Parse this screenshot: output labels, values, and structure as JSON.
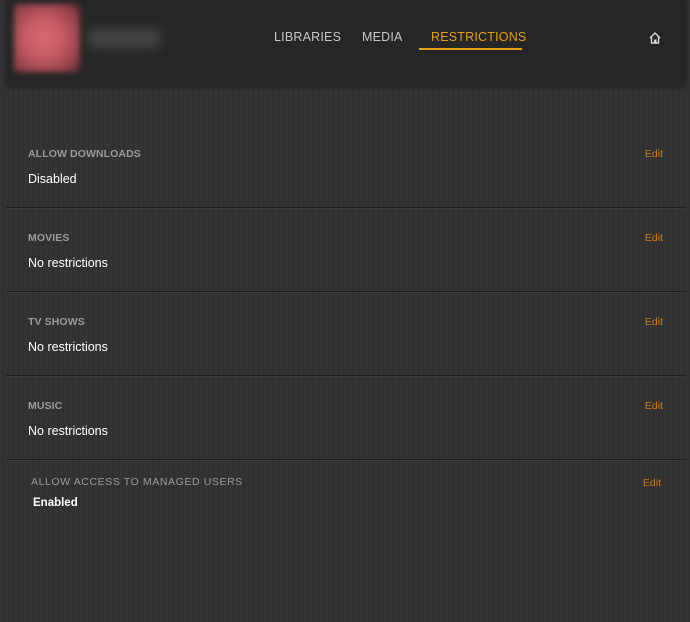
{
  "header": {
    "tabs": [
      {
        "label": "LIBRARIES",
        "active": false
      },
      {
        "label": "MEDIA",
        "active": false
      },
      {
        "label": "RESTRICTIONS",
        "active": true
      }
    ],
    "home_icon": "home-icon"
  },
  "sections": [
    {
      "title": "ALLOW DOWNLOADS",
      "value": "Disabled",
      "edit": "Edit"
    },
    {
      "title": "MOVIES",
      "value": "No restrictions",
      "edit": "Edit"
    },
    {
      "title": "TV SHOWS",
      "value": "No restrictions",
      "edit": "Edit"
    },
    {
      "title": "MUSIC",
      "value": "No restrictions",
      "edit": "Edit"
    },
    {
      "title": "ALLOW ACCESS TO MANAGED USERS",
      "value": "Enabled",
      "edit": "Edit"
    }
  ],
  "colors": {
    "accent": "#e5a00d",
    "edit_link": "#cc7b19",
    "background": "#323232",
    "header_bg": "#262626"
  }
}
